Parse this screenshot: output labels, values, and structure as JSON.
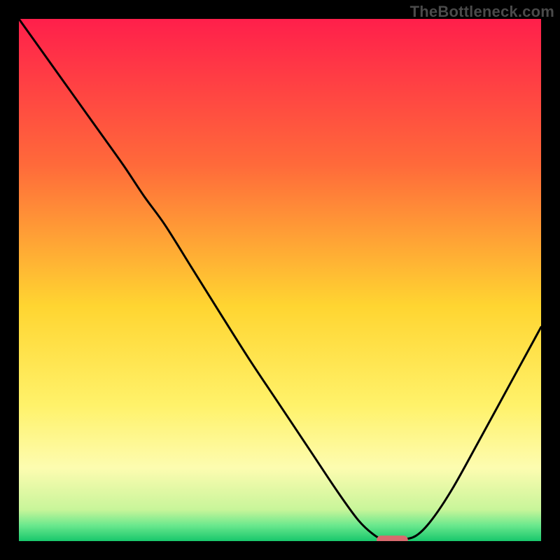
{
  "watermark": "TheBottleneck.com",
  "chart_data": {
    "type": "line",
    "title": "",
    "xlabel": "",
    "ylabel": "",
    "xlim": [
      0,
      100
    ],
    "ylim": [
      0,
      100
    ],
    "grid": false,
    "legend": false,
    "background_gradient": {
      "stops": [
        {
          "offset": 0.0,
          "color": "#ff1f4b"
        },
        {
          "offset": 0.28,
          "color": "#ff6a3a"
        },
        {
          "offset": 0.55,
          "color": "#ffd531"
        },
        {
          "offset": 0.74,
          "color": "#fff26a"
        },
        {
          "offset": 0.86,
          "color": "#fdfcb0"
        },
        {
          "offset": 0.94,
          "color": "#c8f59a"
        },
        {
          "offset": 0.97,
          "color": "#6ae88d"
        },
        {
          "offset": 1.0,
          "color": "#18c76c"
        }
      ]
    },
    "series": [
      {
        "name": "bottleneck-curve",
        "color": "#000000",
        "x": [
          0.0,
          5,
          10,
          15,
          20,
          24,
          28,
          33,
          38,
          44,
          50,
          56,
          61,
          65,
          68,
          70,
          73,
          76,
          79,
          83,
          88,
          94,
          100
        ],
        "y": [
          100,
          93,
          86,
          79,
          72,
          66,
          60.5,
          52.5,
          44.5,
          35,
          26,
          17,
          9.5,
          4,
          1.2,
          0.3,
          0.3,
          1.0,
          4,
          10,
          19,
          30,
          41
        ]
      }
    ],
    "marker": {
      "name": "optimal-point",
      "shape": "capsule",
      "color": "#d86a6e",
      "x_center": 71.5,
      "y": 0.2,
      "width_pct": 6,
      "height_pct": 1.7
    }
  }
}
